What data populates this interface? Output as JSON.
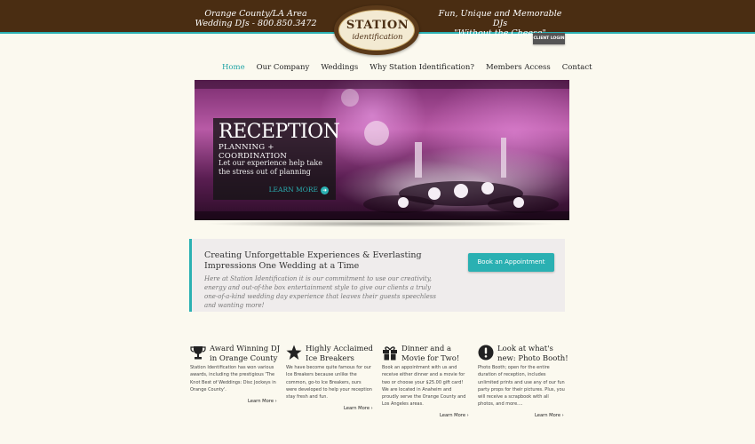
{
  "header": {
    "left_line1": "Orange County/LA Area",
    "left_line2": "Wedding DJs  -  800.850.3472",
    "right_line1": "Fun, Unique and Memorable DJs",
    "right_line2": "\"Without the Cheese\"",
    "logo_line1": "STATION",
    "logo_line2": "identification",
    "client_login": "CLIENT LOGIN",
    "brand_color": "#4a2d12",
    "accent_color": "#2ab0b2"
  },
  "nav": {
    "items": [
      {
        "label": "Home",
        "active": true
      },
      {
        "label": "Our Company",
        "active": false
      },
      {
        "label": "Weddings",
        "active": false
      },
      {
        "label": "Why Station Identification?",
        "active": false
      },
      {
        "label": "Members Access",
        "active": false
      },
      {
        "label": "Contact",
        "active": false
      }
    ]
  },
  "hero": {
    "title": "RECEPTION",
    "subtitle": "PLANNING + COORDINATION",
    "description": "Let our experience help take the stress out of planning",
    "more": "LEARN MORE"
  },
  "banner": {
    "title": "Creating Unforgettable Experiences & Everlasting Impressions One Wedding at a Time",
    "text": "Here at Station Identification it is our commitment to use our creativity, energy and out-of-the box entertainment style to give our clients a truly one-of-a-kind wedding day experience that leaves their guests speechless and wanting more!",
    "button": "Book an Appointment"
  },
  "features": [
    {
      "icon": "trophy-icon",
      "title": "Award Winning DJ in Orange County",
      "text": "Station Identification has won various awards, including the prestigious 'The Knot Best of Weddings: Disc Jockeys in Orange County'.",
      "more": "Learn More  ›"
    },
    {
      "icon": "star-icon",
      "title": "Highly Acclaimed Ice Breakers",
      "text": "We have become quite famous for our Ice Breakers because unlike the common, go-to Ice Breakers, ours were developed to help your reception stay fresh and fun.",
      "more": "Learn More  ›"
    },
    {
      "icon": "gift-icon",
      "title": "Dinner and a Movie for Two!",
      "text": "Book an appointment with us and receive either dinner and a movie for two or choose your $25.00 gift card! We are located in Anaheim and proudly serve the Orange County and Los Angeles areas.",
      "more": "Learn More  ›"
    },
    {
      "icon": "exclamation-icon",
      "title": "Look at what's new: Photo Booth!",
      "text": "Photo Booth; open for the entire duration of reception, includes unlimited prints and use any of our fun party props for their pictures. Plus, you will receive a scrapbook with all photos, and more....",
      "more": "Learn More  ›"
    }
  ]
}
